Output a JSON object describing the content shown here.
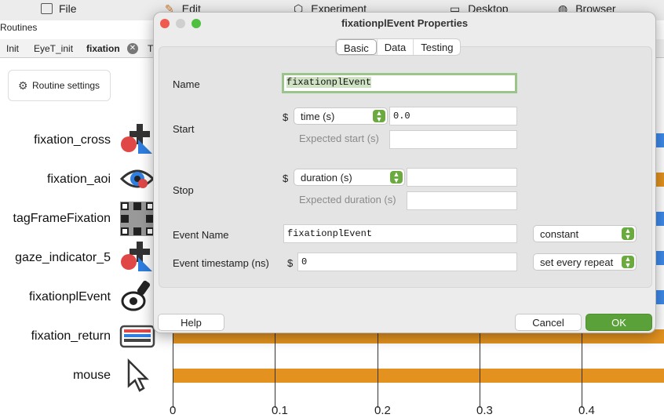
{
  "menubar": {
    "file": "File",
    "edit": "Edit",
    "experiment": "Experiment",
    "desktop": "Desktop",
    "browser": "Browser"
  },
  "routines_title": "Routines",
  "routine_tabs": [
    {
      "label": "Init"
    },
    {
      "label": "EyeT_init"
    },
    {
      "label": "fixation"
    },
    {
      "label": "T"
    }
  ],
  "routine_settings_label": "Routine settings",
  "components": [
    {
      "name": "fixation_cross",
      "icon": "cross-shape-icon"
    },
    {
      "name": "fixation_aoi",
      "icon": "eye-aoi-icon"
    },
    {
      "name": "tagFrameFixation",
      "icon": "apriltag-frame-icon"
    },
    {
      "name": "gaze_indicator_5",
      "icon": "cross-shape-icon"
    },
    {
      "name": "fixationplEvent",
      "icon": "stamp-event-icon"
    },
    {
      "name": "fixation_return",
      "icon": "keyboard-icon"
    },
    {
      "name": "mouse",
      "icon": "mouse-cursor-icon"
    }
  ],
  "timeline": {
    "ticks": [
      "0",
      "0.1",
      "0.2",
      "0.3",
      "0.4"
    ],
    "bar_color": "#e3921f",
    "blue_color": "#3d8ae8"
  },
  "dialog": {
    "title": "fixationplEvent Properties",
    "tabs": [
      "Basic",
      "Data",
      "Testing"
    ],
    "active_tab": "Basic",
    "name": {
      "label": "Name",
      "value": "fixationplEvent"
    },
    "start": {
      "label": "Start",
      "dollar": "$",
      "type": "time (s)",
      "value": "0.0",
      "expected_label": "Expected start (s)",
      "expected_value": ""
    },
    "stop": {
      "label": "Stop",
      "dollar": "$",
      "type": "duration (s)",
      "value": "",
      "expected_label": "Expected duration (s)",
      "expected_value": ""
    },
    "event_name": {
      "label": "Event Name",
      "value": "fixationplEvent",
      "mode": "constant"
    },
    "event_timestamp": {
      "label": "Event timestamp (ns)",
      "dollar": "$",
      "value": "0",
      "mode": "set every repeat"
    },
    "help_label": "Help",
    "cancel_label": "Cancel",
    "ok_label": "OK",
    "accent_color": "#5aa13a"
  }
}
